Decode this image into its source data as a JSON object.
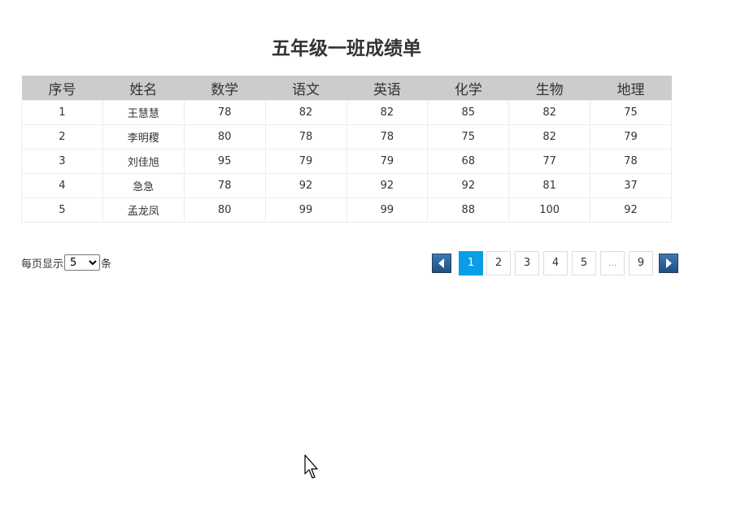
{
  "title": "五年级一班成绩单",
  "table": {
    "headers": [
      "序号",
      "姓名",
      "数学",
      "语文",
      "英语",
      "化学",
      "生物",
      "地理"
    ],
    "rows": [
      [
        "1",
        "王慧慧",
        "78",
        "82",
        "82",
        "85",
        "82",
        "75"
      ],
      [
        "2",
        "李明稷",
        "80",
        "78",
        "78",
        "75",
        "82",
        "79"
      ],
      [
        "3",
        "刘佳旭",
        "95",
        "79",
        "79",
        "68",
        "77",
        "78"
      ],
      [
        "4",
        "急急",
        "78",
        "92",
        "92",
        "92",
        "81",
        "37"
      ],
      [
        "5",
        "孟龙凤",
        "80",
        "99",
        "99",
        "88",
        "100",
        "92"
      ]
    ]
  },
  "page_size": {
    "prefix": "每页显示",
    "selected": "5",
    "options": [
      "5"
    ],
    "suffix": "条"
  },
  "pagination": {
    "prev_icon": "arrow-left-icon",
    "next_icon": "arrow-right-icon",
    "pages": [
      "1",
      "2",
      "3",
      "4",
      "5",
      "...",
      "9"
    ],
    "current": "1",
    "colors": {
      "active": "#0a9ee8",
      "nav": "#1f4f82"
    }
  }
}
